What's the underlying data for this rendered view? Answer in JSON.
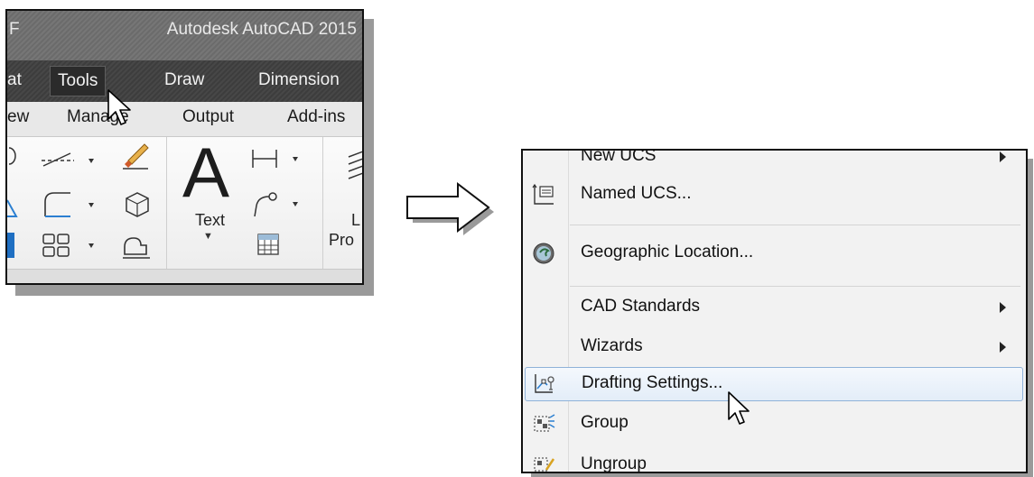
{
  "window": {
    "title_partial": "Autodesk AutoCAD 2015",
    "title_left_letter": "F"
  },
  "menubar": {
    "items": [
      "at",
      "Tools",
      "Draw",
      "Dimension"
    ],
    "active": "Tools"
  },
  "ribbon_tabs": [
    "ew",
    "Manage",
    "Output",
    "Add-ins"
  ],
  "ribbon": {
    "text_button_label": "Text",
    "text_big_glyph": "A",
    "layer_label_partial_1": "L",
    "layer_label_partial_2": "Pro"
  },
  "context_menu": {
    "items": [
      {
        "label": "New UCS",
        "icon": "new-ucs-icon",
        "submenu": true
      },
      {
        "label": "Named UCS...",
        "icon": "named-ucs-icon",
        "submenu": false
      },
      {
        "label": "Geographic Location...",
        "icon": "geographic-location-icon",
        "submenu": false
      },
      {
        "label": "CAD Standards",
        "icon": "",
        "submenu": true
      },
      {
        "label": "Wizards",
        "icon": "",
        "submenu": true
      },
      {
        "label": "Drafting Settings...",
        "icon": "drafting-settings-icon",
        "submenu": false,
        "highlighted": true
      },
      {
        "label": "Group",
        "icon": "group-icon",
        "submenu": false
      },
      {
        "label": "Ungroup",
        "icon": "ungroup-icon",
        "submenu": false
      }
    ]
  },
  "colors": {
    "title_bar": "#6f6f6f",
    "menu_bar": "#404040",
    "highlight_border": "#8fb2d9"
  }
}
